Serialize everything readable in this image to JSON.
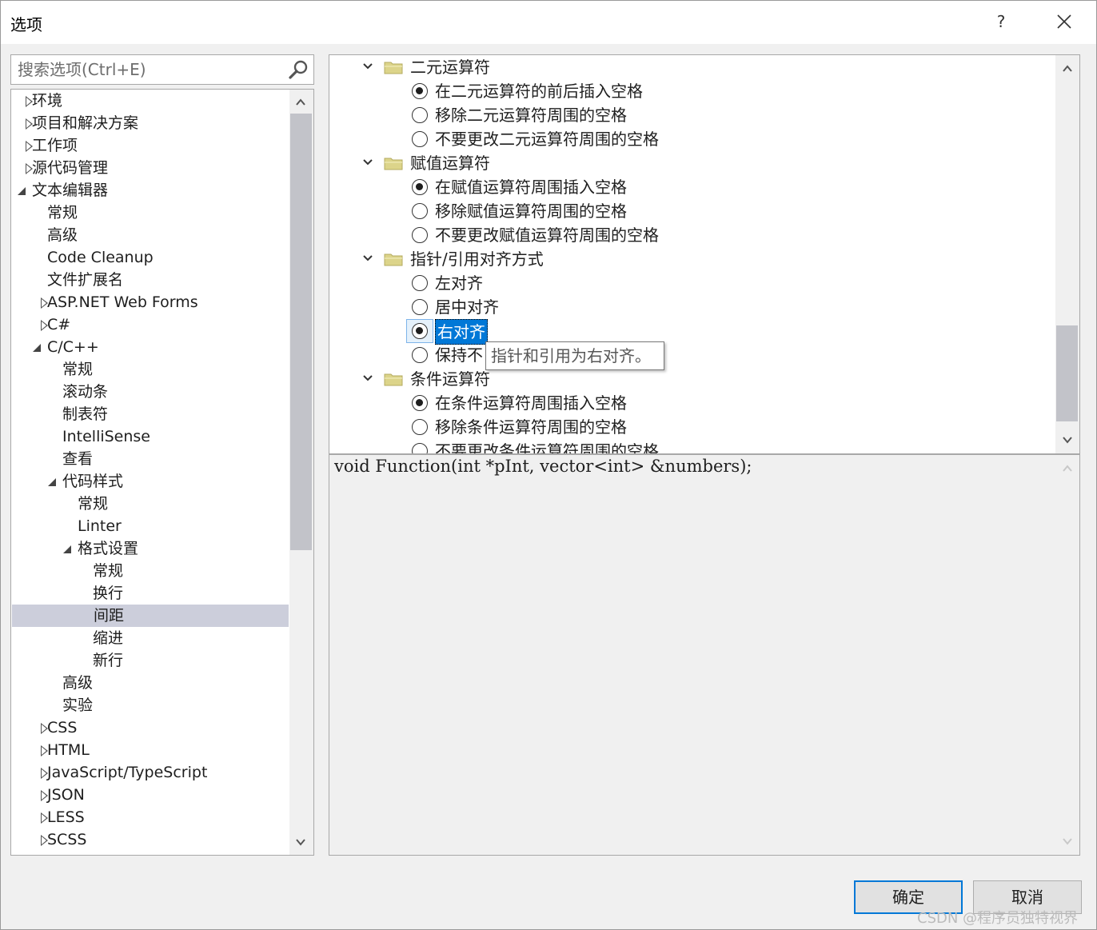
{
  "window": {
    "title": "选项",
    "help": "?",
    "close": "✕"
  },
  "search": {
    "placeholder": "搜索选项(Ctrl+E)"
  },
  "tree": [
    {
      "label": "环境",
      "state": "collapsed",
      "level": 0
    },
    {
      "label": "项目和解决方案",
      "state": "collapsed",
      "level": 0
    },
    {
      "label": "工作项",
      "state": "collapsed",
      "level": 0
    },
    {
      "label": "源代码管理",
      "state": "collapsed",
      "level": 0
    },
    {
      "label": "文本编辑器",
      "state": "expanded",
      "level": 0
    },
    {
      "label": "常规",
      "state": "leaf",
      "level": 1
    },
    {
      "label": "高级",
      "state": "leaf",
      "level": 1
    },
    {
      "label": "Code Cleanup",
      "state": "leaf",
      "level": 1
    },
    {
      "label": "文件扩展名",
      "state": "leaf",
      "level": 1
    },
    {
      "label": "ASP.NET Web Forms",
      "state": "collapsed",
      "level": 1
    },
    {
      "label": "C#",
      "state": "collapsed",
      "level": 1
    },
    {
      "label": "C/C++",
      "state": "expanded",
      "level": 1
    },
    {
      "label": "常规",
      "state": "leaf",
      "level": 2
    },
    {
      "label": "滚动条",
      "state": "leaf",
      "level": 2
    },
    {
      "label": "制表符",
      "state": "leaf",
      "level": 2
    },
    {
      "label": "IntelliSense",
      "state": "leaf",
      "level": 2
    },
    {
      "label": "查看",
      "state": "leaf",
      "level": 2
    },
    {
      "label": "代码样式",
      "state": "expanded",
      "level": 2
    },
    {
      "label": "常规",
      "state": "leaf",
      "level": 3
    },
    {
      "label": "Linter",
      "state": "leaf",
      "level": 3
    },
    {
      "label": "格式设置",
      "state": "expanded",
      "level": 3
    },
    {
      "label": "常规",
      "state": "leaf",
      "level": 4
    },
    {
      "label": "换行",
      "state": "leaf",
      "level": 4
    },
    {
      "label": "间距",
      "state": "leaf",
      "level": 4,
      "selected": true
    },
    {
      "label": "缩进",
      "state": "leaf",
      "level": 4
    },
    {
      "label": "新行",
      "state": "leaf",
      "level": 4
    },
    {
      "label": "高级",
      "state": "leaf",
      "level": 2
    },
    {
      "label": "实验",
      "state": "leaf",
      "level": 2
    },
    {
      "label": "CSS",
      "state": "collapsed",
      "level": 1
    },
    {
      "label": "HTML",
      "state": "collapsed",
      "level": 1
    },
    {
      "label": "JavaScript/TypeScript",
      "state": "collapsed",
      "level": 1
    },
    {
      "label": "JSON",
      "state": "collapsed",
      "level": 1
    },
    {
      "label": "LESS",
      "state": "collapsed",
      "level": 1
    },
    {
      "label": "SCSS",
      "state": "collapsed",
      "level": 1
    }
  ],
  "options": [
    {
      "type": "group",
      "label": "二元运算符"
    },
    {
      "type": "radio",
      "label": "在二元运算符的前后插入空格",
      "checked": true
    },
    {
      "type": "radio",
      "label": "移除二元运算符周围的空格",
      "checked": false
    },
    {
      "type": "radio",
      "label": "不要更改二元运算符周围的空格",
      "checked": false
    },
    {
      "type": "group",
      "label": "赋值运算符"
    },
    {
      "type": "radio",
      "label": "在赋值运算符周围插入空格",
      "checked": true
    },
    {
      "type": "radio",
      "label": "移除赋值运算符周围的空格",
      "checked": false
    },
    {
      "type": "radio",
      "label": "不要更改赋值运算符周围的空格",
      "checked": false
    },
    {
      "type": "group",
      "label": "指针/引用对齐方式"
    },
    {
      "type": "radio",
      "label": "左对齐",
      "checked": false
    },
    {
      "type": "radio",
      "label": "居中对齐",
      "checked": false
    },
    {
      "type": "radio",
      "label": "右对齐",
      "checked": true,
      "focused": true
    },
    {
      "type": "radio",
      "label": "保持不",
      "checked": false
    },
    {
      "type": "group",
      "label": "条件运算符"
    },
    {
      "type": "radio",
      "label": "在条件运算符周围插入空格",
      "checked": true
    },
    {
      "type": "radio",
      "label": "移除条件运算符周围的空格",
      "checked": false
    },
    {
      "type": "radio",
      "label": "不要更改条件运算符周围的空格",
      "checked": false
    }
  ],
  "tooltip": "指针和引用为右对齐。",
  "preview": {
    "code": "void Function(int *pInt, vector<int> &numbers);"
  },
  "buttons": {
    "ok": "确定",
    "cancel": "取消"
  },
  "watermark": "CSDN @程序员独特视界",
  "colors": {
    "selection_blue": "#0078d7",
    "tree_selected": "#cccedb",
    "folder": "#dcd48a"
  }
}
